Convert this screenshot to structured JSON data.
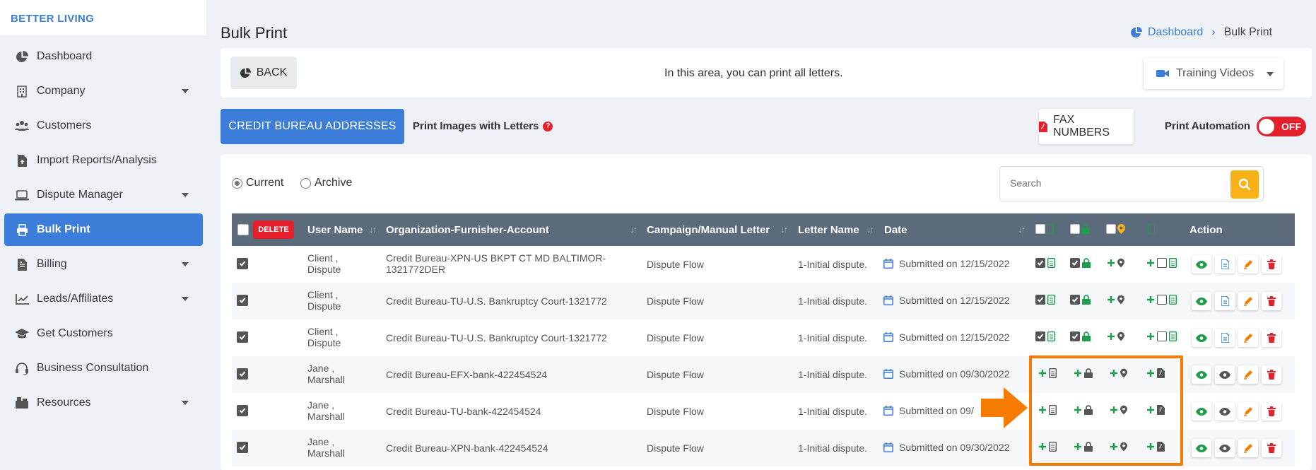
{
  "brand": "BETTER LIVING",
  "sidebar": {
    "items": [
      {
        "label": "Dashboard",
        "icon": "pie-chart-icon",
        "caret": false,
        "active": false
      },
      {
        "label": "Company",
        "icon": "building-icon",
        "caret": true,
        "active": false
      },
      {
        "label": "Customers",
        "icon": "users-icon",
        "caret": false,
        "active": false
      },
      {
        "label": "Import Reports/Analysis",
        "icon": "file-upload-icon",
        "caret": false,
        "active": false
      },
      {
        "label": "Dispute Manager",
        "icon": "laptop-icon",
        "caret": true,
        "active": false
      },
      {
        "label": "Bulk Print",
        "icon": "printer-icon",
        "caret": false,
        "active": true
      },
      {
        "label": "Billing",
        "icon": "invoice-icon",
        "caret": true,
        "active": false
      },
      {
        "label": "Leads/Affiliates",
        "icon": "chart-line-icon",
        "caret": true,
        "active": false
      },
      {
        "label": "Get Customers",
        "icon": "graduation-cap-icon",
        "caret": false,
        "active": false
      },
      {
        "label": "Business Consultation",
        "icon": "headset-icon",
        "caret": false,
        "active": false
      },
      {
        "label": "Resources",
        "icon": "box-icon",
        "caret": true,
        "active": false
      }
    ]
  },
  "header": {
    "title": "Bulk Print",
    "breadcrumb": {
      "home": "Dashboard",
      "current": "Bulk Print"
    }
  },
  "toolbar": {
    "back_label": "BACK",
    "info": "In this area, you can print all letters.",
    "training_label": "Training Videos"
  },
  "actions": {
    "credit_bureau_label": "CREDIT BUREAU ADDRESSES",
    "print_images_label": "Print Images with Letters",
    "help": "?",
    "fax_label": "FAX NUMBERS",
    "print_automation_label": "Print Automation",
    "toggle_label": "OFF"
  },
  "filters": {
    "current_label": "Current",
    "archive_label": "Archive",
    "search_placeholder": "Search"
  },
  "table": {
    "delete_label": "DELETE",
    "columns": {
      "user": "User Name",
      "org": "Organization-Furnisher-Account",
      "campaign": "Campaign/Manual Letter",
      "letter": "Letter Name",
      "date": "Date",
      "action": "Action"
    },
    "rows": [
      {
        "user1": "Client ,",
        "user2": "Dispute",
        "org1": "Credit Bureau-XPN-US BKPT CT MD BALTIMOR-",
        "org2": "1321772DER",
        "campaign": "Dispute Flow",
        "letter": "1-Initial dispute.",
        "date": "Submitted on 12/15/2022",
        "printed": true
      },
      {
        "user1": "Client ,",
        "user2": "Dispute",
        "org1": "Credit Bureau-TU-U.S. Bankruptcy Court-1321772",
        "org2": "",
        "campaign": "Dispute Flow",
        "letter": "1-Initial dispute.",
        "date": "Submitted on 12/15/2022",
        "printed": true
      },
      {
        "user1": "Client ,",
        "user2": "Dispute",
        "org1": "Credit Bureau-TU-U.S. Bankruptcy Court-1321772",
        "org2": "",
        "campaign": "Dispute Flow",
        "letter": "1-Initial dispute.",
        "date": "Submitted on 12/15/2022",
        "printed": true
      },
      {
        "user1": "Jane ,",
        "user2": "Marshall",
        "org1": "Credit Bureau-EFX-bank-422454524",
        "org2": "",
        "campaign": "Dispute Flow",
        "letter": "1-Initial dispute.",
        "date": "Submitted on 09/30/2022",
        "printed": false
      },
      {
        "user1": "Jane ,",
        "user2": "Marshall",
        "org1": "Credit Bureau-TU-bank-422454524",
        "org2": "",
        "campaign": "Dispute Flow",
        "letter": "1-Initial dispute.",
        "date": "Submitted on 09/",
        "printed": false
      },
      {
        "user1": "Jane ,",
        "user2": "Marshall",
        "org1": "Credit Bureau-XPN-bank-422454524",
        "org2": "",
        "campaign": "Dispute Flow",
        "letter": "1-Initial dispute.",
        "date": "Submitted on 09/30/2022",
        "printed": false
      }
    ]
  },
  "colors": {
    "primary": "#3b7dd8",
    "header": "#5b6b7b",
    "danger": "#e3202c",
    "success": "#1e9e4a",
    "warning": "#f9b115",
    "highlight": "#f57c00"
  }
}
